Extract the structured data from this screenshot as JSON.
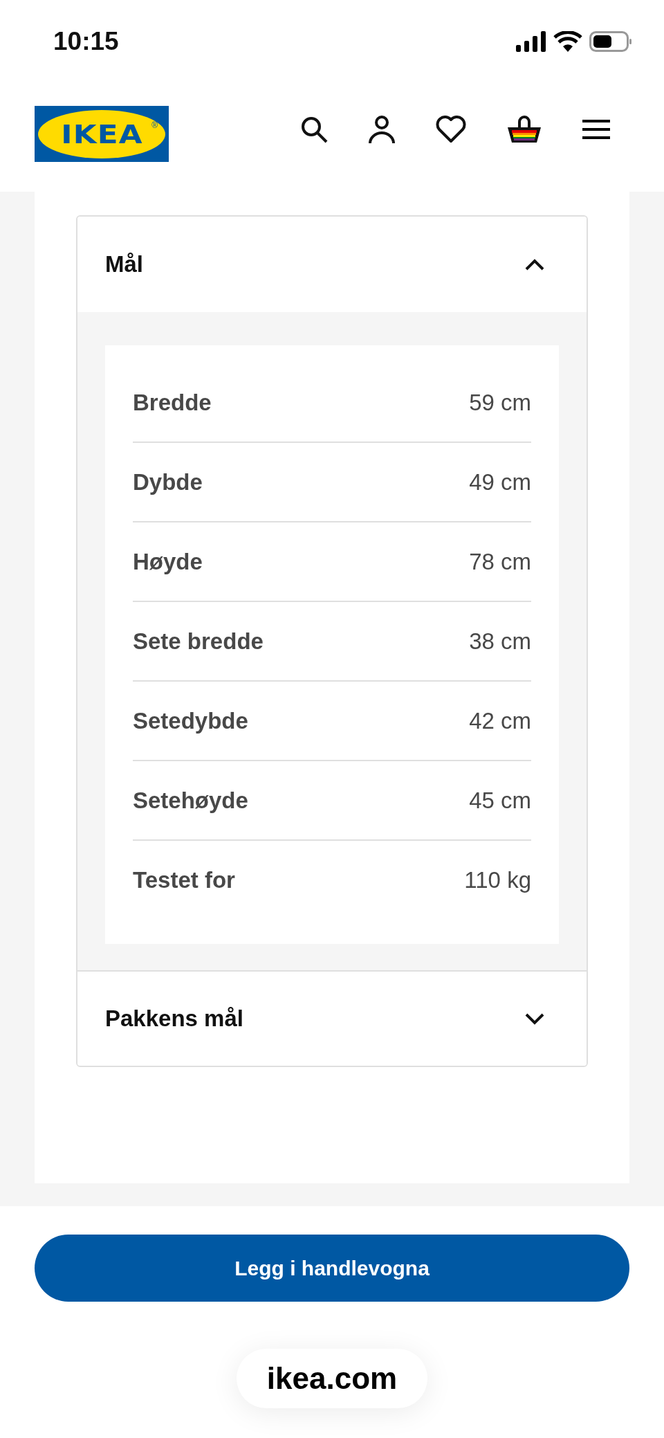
{
  "status_bar": {
    "time": "10:15"
  },
  "header": {
    "logo": {
      "text": "IKEA",
      "mark": "®"
    }
  },
  "sections": [
    {
      "title": "Mål",
      "expanded": true,
      "rows": [
        {
          "label": "Bredde",
          "value": "59 cm"
        },
        {
          "label": "Dybde",
          "value": "49 cm"
        },
        {
          "label": "Høyde",
          "value": "78 cm"
        },
        {
          "label": "Sete bredde",
          "value": "38 cm"
        },
        {
          "label": "Setedybde",
          "value": "42 cm"
        },
        {
          "label": "Setehøyde",
          "value": "45 cm"
        },
        {
          "label": "Testet for",
          "value": "110 kg"
        }
      ]
    },
    {
      "title": "Pakkens mål",
      "expanded": false
    }
  ],
  "add_to_cart_button": "Legg i handlevogna",
  "url_bar": "ikea.com"
}
